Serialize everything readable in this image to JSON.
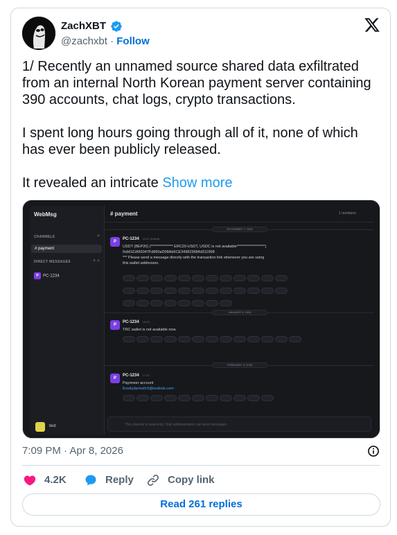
{
  "author": {
    "display_name": "ZachXBT",
    "handle": "@zachxbt",
    "separator": "·",
    "follow_label": "Follow"
  },
  "tweet": {
    "paragraphs": [
      "1/ Recently an unnamed source shared data exfiltrated from an internal North Korean payment server containing 390 accounts, chat logs, crypto transactions.",
      "I spent long hours going through all of it, none of which has ever been publicly released."
    ],
    "last_paragraph": "It revealed an intricate ",
    "show_more": "Show more"
  },
  "screenshot": {
    "app_name": "WebMsg",
    "channels_label": "CHANNELS",
    "channel_name": "# payment",
    "direct_messages_label": "DIRECT MESSAGES",
    "dm_badge": "P",
    "dm_user": "PC-1234",
    "header_title": "# payment",
    "members_label": "1 members",
    "user_label": "test",
    "dates": [
      "DECEMBER 7, 2025",
      "JANUARY 5, 2026",
      "FEBRUARY 3, 2026"
    ],
    "messages": [
      {
        "author": "PC-1234",
        "time": "23:42 (edited)",
        "lines": [
          "USDT (BEP20) (*************** ERC20-USDT, USDC is not available*******************)",
          "0xb61DA55047Fd890aD08Ab5CE349823684d311998",
          "*** Please send a message directly with the transaction link whenever you are using",
          "this wallet addresses."
        ]
      },
      {
        "author": "PC-1234",
        "time": "19:03",
        "lines": [
          "TRC wallet is not available now."
        ]
      },
      {
        "author": "PC-1234",
        "time": "17:10",
        "lines": [
          "Payoneer account"
        ],
        "link": "llcoskyfarmsllc9@outlook.com"
      }
    ],
    "composer_placeholder": "This channel is read-only. Only administrators can send messages."
  },
  "meta": {
    "time": "7:09 PM",
    "separator": "·",
    "date": "Apr 8, 2026"
  },
  "actions": {
    "likes": "4.2K",
    "reply_label": "Reply",
    "copy_label": "Copy link"
  },
  "read_replies_label": "Read 261 replies",
  "colors": {
    "link_blue": "#1d9bf0",
    "follow_blue": "#006fd6",
    "like_pink": "#f91880",
    "muted": "#536471",
    "border": "#cfd9de"
  }
}
